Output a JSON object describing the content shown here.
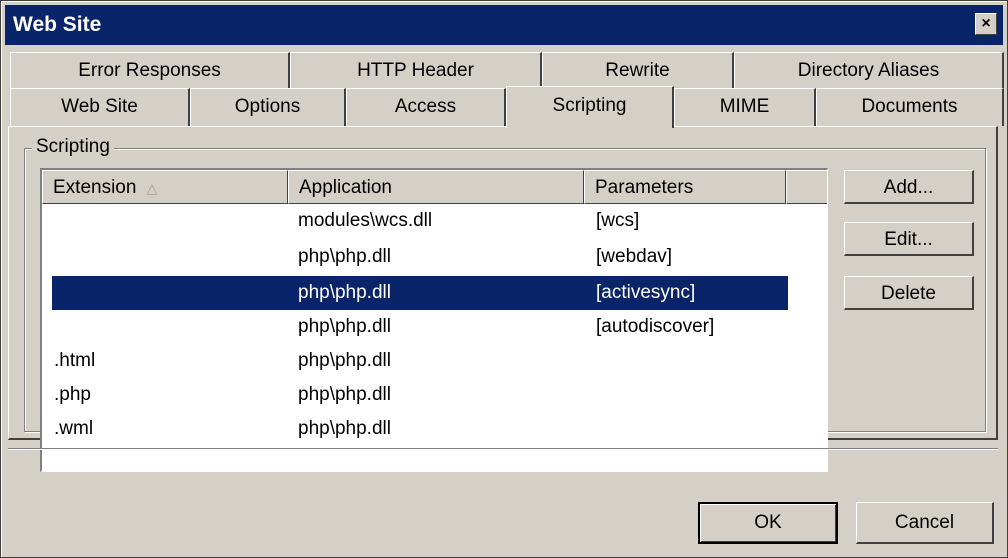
{
  "window": {
    "title": "Web Site",
    "close_glyph": "×"
  },
  "tabs_row1": [
    {
      "label": "Error Responses"
    },
    {
      "label": "HTTP Header"
    },
    {
      "label": "Rewrite"
    },
    {
      "label": "Directory Aliases"
    }
  ],
  "tabs_row2": [
    {
      "label": "Web Site"
    },
    {
      "label": "Options"
    },
    {
      "label": "Access"
    },
    {
      "label": "Scripting"
    },
    {
      "label": "MIME"
    },
    {
      "label": "Documents"
    }
  ],
  "active_tab": "Scripting",
  "scripting": {
    "group_label": "Scripting",
    "columns": [
      "Extension",
      "Application",
      "Parameters"
    ],
    "sort_icon": "sort-ascending-icon",
    "rows": [
      {
        "extension": "",
        "application": "modules\\wcs.dll",
        "parameters": "[wcs]"
      },
      {
        "extension": "",
        "application": "php\\php.dll",
        "parameters": "[webdav]"
      },
      {
        "extension": "",
        "application": "php\\php.dll",
        "parameters": "[activesync]"
      },
      {
        "extension": "",
        "application": "php\\php.dll",
        "parameters": "[autodiscover]"
      },
      {
        "extension": ".html",
        "application": "php\\php.dll",
        "parameters": ""
      },
      {
        "extension": ".php",
        "application": "php\\php.dll",
        "parameters": ""
      },
      {
        "extension": ".wml",
        "application": "php\\php.dll",
        "parameters": ""
      }
    ],
    "selected_row": 2,
    "buttons": {
      "add": "Add...",
      "edit": "Edit...",
      "delete": "Delete"
    }
  },
  "footer": {
    "ok": "OK",
    "cancel": "Cancel"
  },
  "colors": {
    "face": "#d4d0c8",
    "selection": "#0a246a",
    "title_bar": "#0a246a"
  }
}
